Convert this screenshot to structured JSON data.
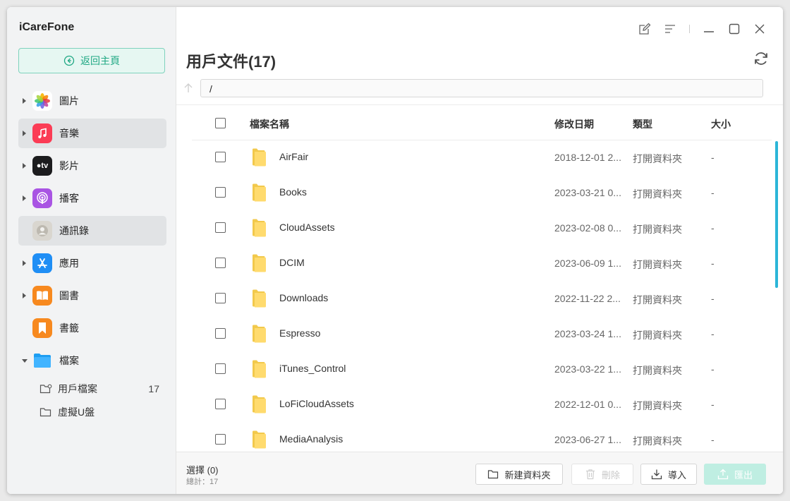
{
  "app": {
    "title": "iCareFone"
  },
  "sidebar": {
    "back_label": "返回主頁",
    "items": [
      {
        "label": "圖片",
        "icon": "photos-icon",
        "color": "#ffffff"
      },
      {
        "label": "音樂",
        "icon": "music-icon",
        "color": "#fb3c55"
      },
      {
        "label": "影片",
        "icon": "tv-icon",
        "color": "#1c1c1e"
      },
      {
        "label": "播客",
        "icon": "podcast-icon",
        "color": "#a954e3"
      },
      {
        "label": "通訊錄",
        "icon": "contacts-icon",
        "color": "#d8d8d8"
      },
      {
        "label": "應用",
        "icon": "appstore-icon",
        "color": "#1f8ef5"
      },
      {
        "label": "圖書",
        "icon": "books-icon",
        "color": "#f7891f"
      },
      {
        "label": "書籤",
        "icon": "bookmark-icon",
        "color": "#f7891f"
      },
      {
        "label": "檔案",
        "icon": "folder-icon",
        "color": "#1e9ef2"
      }
    ],
    "sub_items": [
      {
        "label": "用戶檔案",
        "count": "17"
      },
      {
        "label": "虛擬U盤"
      }
    ]
  },
  "main": {
    "title": "用戶文件(17)",
    "path": "/",
    "columns": {
      "name": "檔案名稱",
      "date": "修改日期",
      "type": "類型",
      "size": "大小"
    },
    "rows": [
      {
        "name": "AirFair",
        "date": "2018-12-01 2...",
        "type": "打開資料夾",
        "size": "-"
      },
      {
        "name": "Books",
        "date": "2023-03-21 0...",
        "type": "打開資料夾",
        "size": "-"
      },
      {
        "name": "CloudAssets",
        "date": "2023-02-08 0...",
        "type": "打開資料夾",
        "size": "-"
      },
      {
        "name": "DCIM",
        "date": "2023-06-09 1...",
        "type": "打開資料夾",
        "size": "-"
      },
      {
        "name": "Downloads",
        "date": "2022-11-22 2...",
        "type": "打開資料夾",
        "size": "-"
      },
      {
        "name": "Espresso",
        "date": "2023-03-24 1...",
        "type": "打開資料夾",
        "size": "-"
      },
      {
        "name": "iTunes_Control",
        "date": "2023-03-22 1...",
        "type": "打開資料夾",
        "size": "-"
      },
      {
        "name": "LoFiCloudAssets",
        "date": "2022-12-01 0...",
        "type": "打開資料夾",
        "size": "-"
      },
      {
        "name": "MediaAnalysis",
        "date": "2023-06-27 1...",
        "type": "打開資料夾",
        "size": "-"
      }
    ]
  },
  "footer": {
    "selected": "選擇 (0)",
    "total": "總計：17",
    "new_folder": "新建資料夾",
    "delete": "刪除",
    "import": "導入",
    "export": "匯出"
  }
}
